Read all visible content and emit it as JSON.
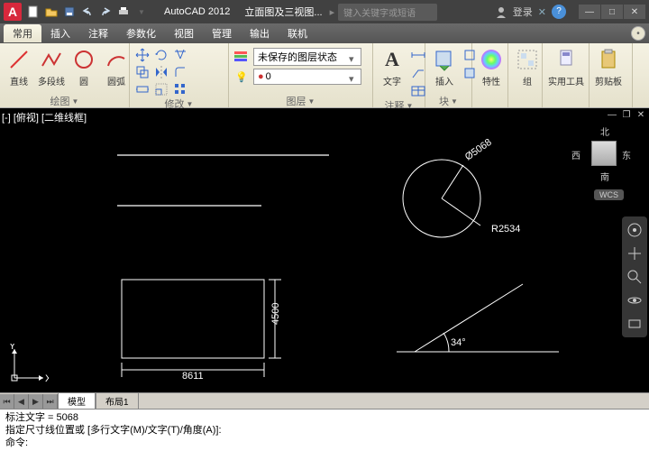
{
  "app": {
    "name": "AutoCAD 2012",
    "document": "立面图及三视图...",
    "search_placeholder": "键入关键字或短语",
    "login": "登录"
  },
  "menu": [
    "常用",
    "插入",
    "注释",
    "参数化",
    "视图",
    "管理",
    "输出",
    "联机"
  ],
  "ribbon": {
    "draw": {
      "label": "绘图",
      "items": [
        "直线",
        "多段线",
        "圆",
        "圆弧"
      ]
    },
    "modify": {
      "label": "修改"
    },
    "layer": {
      "label": "图层",
      "combo": "未保存的图层状态"
    },
    "annotate": {
      "label": "注释",
      "text": "文字"
    },
    "block": {
      "label": "块",
      "insert": "插入"
    },
    "properties": {
      "label": "特性"
    },
    "group": {
      "label": "组"
    },
    "utility": {
      "label": "实用工具"
    },
    "clipboard": {
      "label": "剪贴板"
    }
  },
  "viewport": {
    "tab": "[-] [俯视] [二维线框]",
    "compass": {
      "n": "北",
      "s": "南",
      "e": "东",
      "w": "西"
    },
    "wcs": "WCS",
    "dims": {
      "rect_w": "8611",
      "rect_h": "4500",
      "angle": "34°",
      "circ_r": "R2534",
      "circ_d": "Ø5068"
    },
    "ucs": {
      "x": "X",
      "y": "Y"
    }
  },
  "sheets": {
    "model": "模型",
    "layout1": "布局1"
  },
  "command": {
    "line1": "标注文字 = 5068",
    "line2": "指定尺寸线位置或 [多行文字(M)/文字(T)/角度(A)]:",
    "line3": "命令:"
  }
}
